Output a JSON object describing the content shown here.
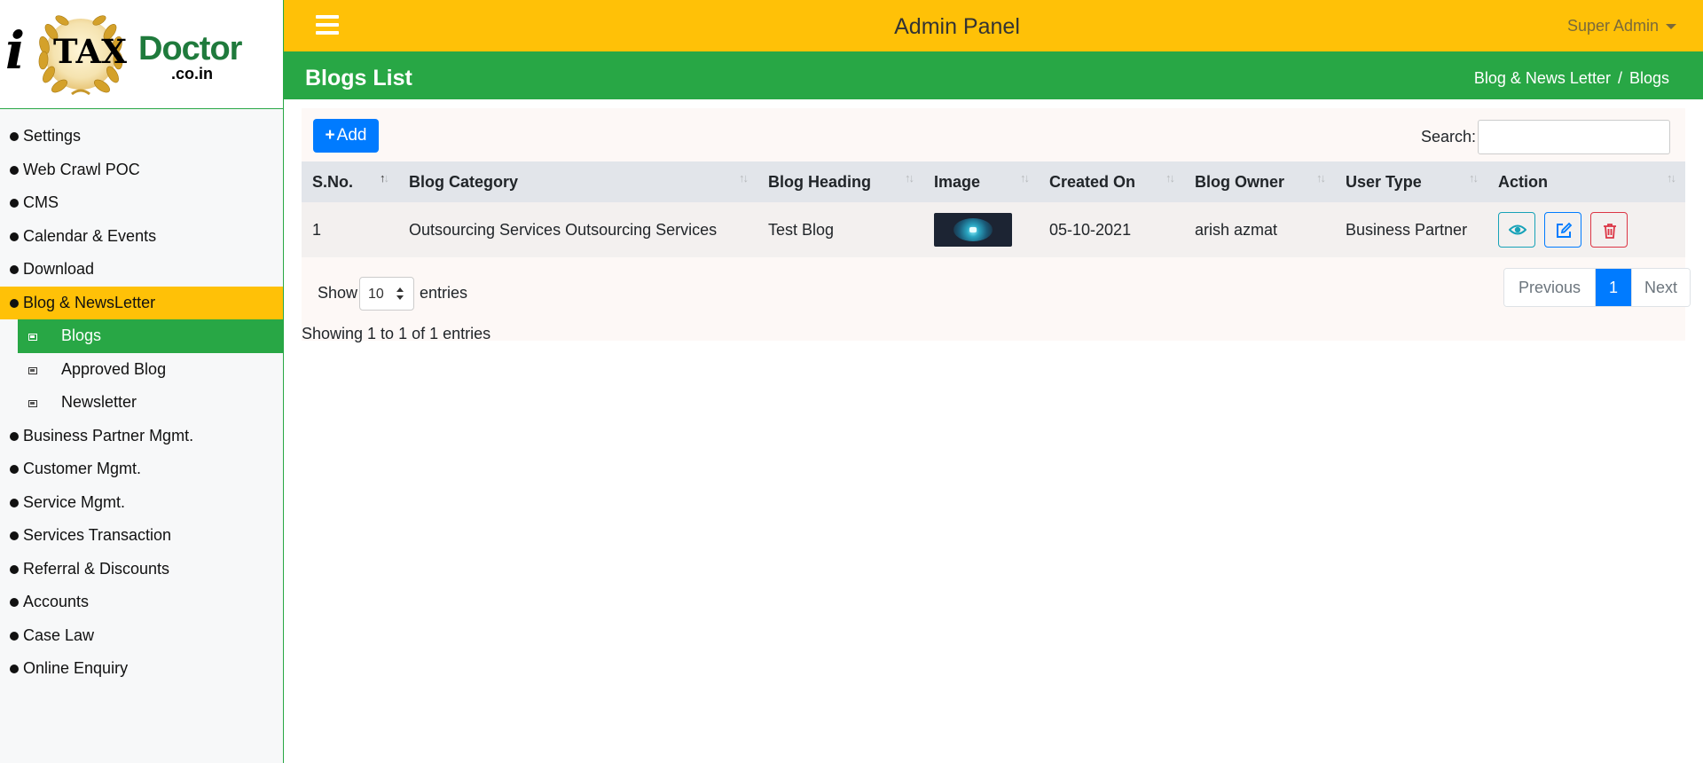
{
  "brand": {
    "logo_i": "i",
    "logo_tax": "TAX",
    "logo_doctor": "Doctor",
    "logo_domain": ".co.in"
  },
  "sidebar": {
    "items": [
      {
        "label": "Settings"
      },
      {
        "label": "Web Crawl POC"
      },
      {
        "label": "CMS"
      },
      {
        "label": "Calendar & Events"
      },
      {
        "label": "Download"
      },
      {
        "label": "Blog & NewsLetter",
        "active": true
      },
      {
        "label": "Business Partner Mgmt."
      },
      {
        "label": "Customer Mgmt."
      },
      {
        "label": "Service Mgmt."
      },
      {
        "label": "Services Transaction"
      },
      {
        "label": "Referral & Discounts"
      },
      {
        "label": "Accounts"
      },
      {
        "label": "Case Law"
      },
      {
        "label": "Online Enquiry"
      }
    ],
    "subitems": [
      {
        "label": "Blogs",
        "active": true
      },
      {
        "label": "Approved Blog"
      },
      {
        "label": "Newsletter"
      }
    ]
  },
  "header": {
    "title": "Admin Panel",
    "user": "Super Admin"
  },
  "page": {
    "title": "Blogs List",
    "breadcrumb": [
      "Blog & News Letter",
      "Blogs"
    ],
    "breadcrumb_sep": "/"
  },
  "toolbar": {
    "add_label": "Add",
    "search_label": "Search:",
    "search_value": ""
  },
  "table": {
    "columns": [
      "S.No.",
      "Blog Category",
      "Blog Heading",
      "Image",
      "Created On",
      "Blog Owner",
      "User Type",
      "Action"
    ],
    "rows": [
      {
        "sno": "1",
        "category": "Outsourcing Services Outsourcing Services",
        "heading": "Test Blog",
        "image": "brain-thumbnail",
        "created": "05-10-2021",
        "owner": "arish azmat",
        "user_type": "Business Partner"
      }
    ]
  },
  "length": {
    "show_label": "Show",
    "value": "10",
    "entries_label": "entries"
  },
  "info": "Showing 1 to 1 of 1 entries",
  "pagination": {
    "previous": "Previous",
    "current": "1",
    "next": "Next"
  },
  "colors": {
    "yellow": "#ffc107",
    "green": "#28a745",
    "primary": "#007bff",
    "info": "#17a2b8",
    "danger": "#dc3545"
  }
}
